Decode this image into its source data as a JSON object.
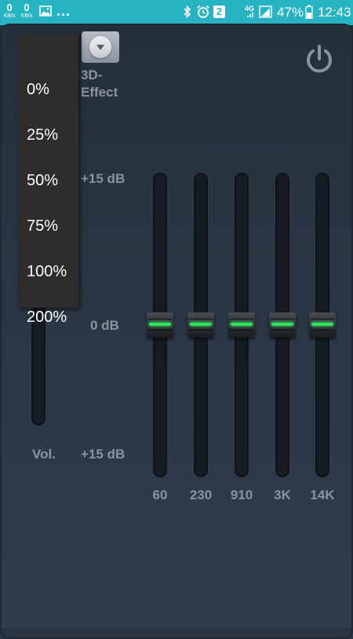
{
  "status_bar": {
    "net_down": {
      "value": "0",
      "unit": "KB/s"
    },
    "net_up": {
      "value": "0",
      "unit": "KB/s"
    },
    "more_notifications": "...",
    "badge": "2",
    "network": "4G",
    "battery": "47%",
    "time": "12:43",
    "icons": [
      "image-icon",
      "bluetooth-icon",
      "alarm-icon",
      "signal-icon",
      "battery-icon"
    ]
  },
  "effect": {
    "button_icon": "chevron-down-icon",
    "label": "3D-Effect"
  },
  "power_icon": "power-icon",
  "scale": {
    "top": "+15 dB",
    "middle": "0 dB",
    "bottom": "+15 dB"
  },
  "volume_label": "Vol.",
  "bands": [
    {
      "label": "60",
      "gain_db": 0
    },
    {
      "label": "230",
      "gain_db": 0
    },
    {
      "label": "910",
      "gain_db": 0
    },
    {
      "label": "3K",
      "gain_db": 0
    },
    {
      "label": "14K",
      "gain_db": 0
    }
  ],
  "dropdown": {
    "items": [
      "0%",
      "25%",
      "50%",
      "75%",
      "100%",
      "200%"
    ]
  },
  "colors": {
    "status_bar": "#26b4c3",
    "background": "#2a3442",
    "knob_indicator": "#2ee05a",
    "label": "#8a939e"
  }
}
